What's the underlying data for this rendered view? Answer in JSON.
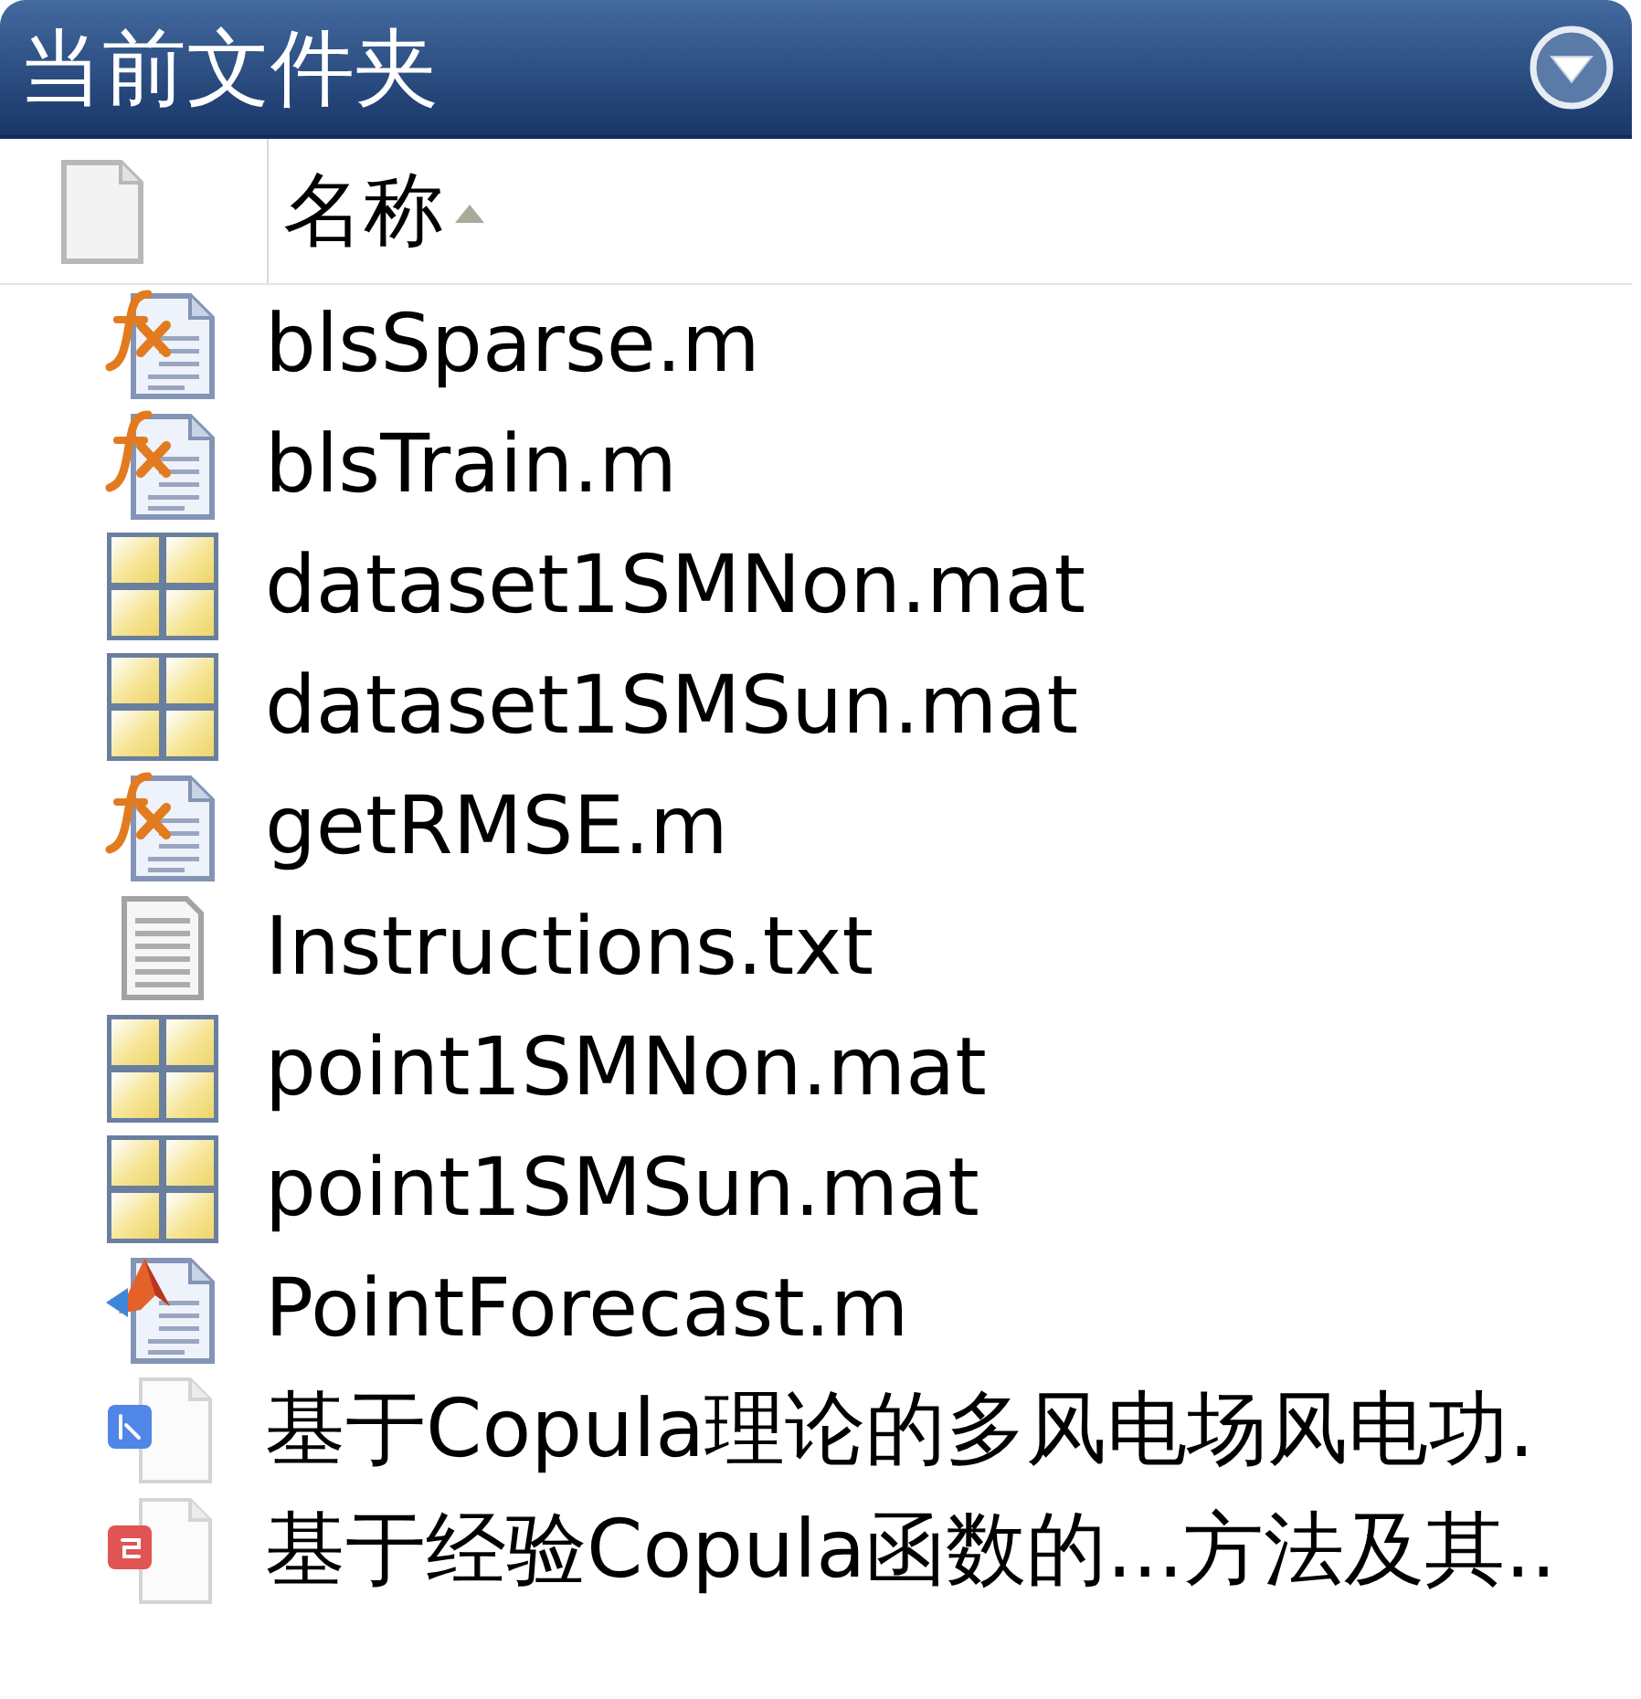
{
  "panel": {
    "title": "当前文件夹"
  },
  "columns": [
    {
      "label": "名称",
      "sort_ascending": true
    }
  ],
  "files": [
    {
      "name": "blsSparse.m",
      "kind": "function"
    },
    {
      "name": "blsTrain.m",
      "kind": "function"
    },
    {
      "name": "dataset1SMNon.mat",
      "kind": "data"
    },
    {
      "name": "dataset1SMSun.mat",
      "kind": "data"
    },
    {
      "name": "getRMSE.m",
      "kind": "function"
    },
    {
      "name": "Instructions.txt",
      "kind": "text"
    },
    {
      "name": "point1SMNon.mat",
      "kind": "data"
    },
    {
      "name": "point1SMSun.mat",
      "kind": "data"
    },
    {
      "name": "PointForecast.m",
      "kind": "script"
    },
    {
      "name": "基于Copula理论的多风电场风电功.",
      "kind": "document"
    },
    {
      "name": "基于经验Copula函数的...方法及其..",
      "kind": "pdf"
    }
  ]
}
